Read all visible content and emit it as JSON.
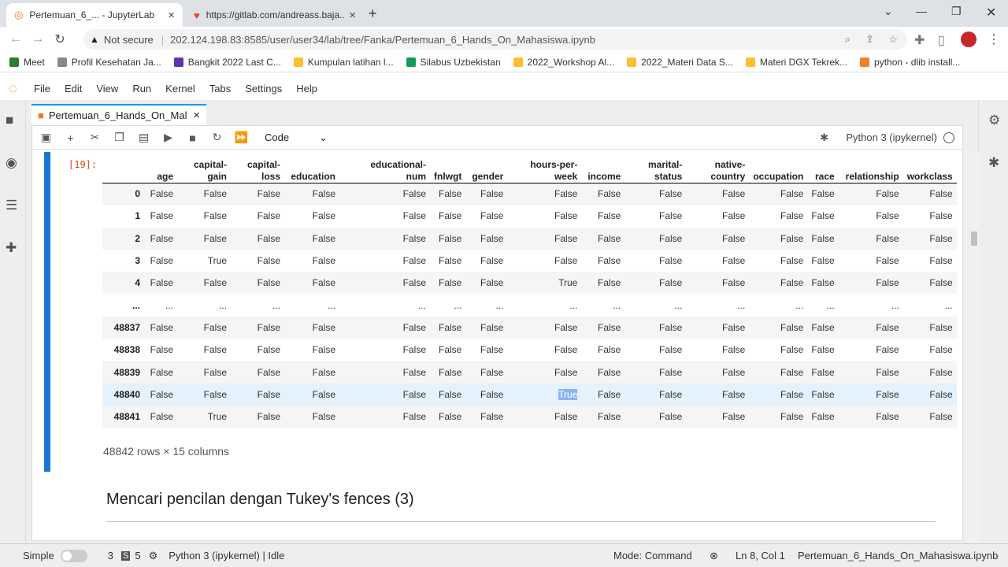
{
  "browser": {
    "tabs": [
      {
        "title": "Pertemuan_6_... - JupyterLab",
        "active": true
      },
      {
        "title": "https://gitlab.com/andreass.baja...",
        "active": false
      }
    ],
    "security_label": "Not secure",
    "url": "202.124.198.83:8585/user/user34/lab/tree/Fanka/Pertemuan_6_Hands_On_Mahasiswa.ipynb",
    "bookmarks": [
      {
        "label": "Meet",
        "color": "#2e7d32"
      },
      {
        "label": "Profil Kesehatan Ja...",
        "color": "#888888"
      },
      {
        "label": "Bangkit 2022 Last C...",
        "color": "#5e35b1"
      },
      {
        "label": "Kumpulan latihan l...",
        "color": "#fbc02d"
      },
      {
        "label": "Silabus Uzbekistan",
        "color": "#0f9d58"
      },
      {
        "label": "2022_Workshop Al...",
        "color": "#fbc02d"
      },
      {
        "label": "2022_Materi Data S...",
        "color": "#fbc02d"
      },
      {
        "label": "Materi DGX Tekrek...",
        "color": "#fbc02d"
      },
      {
        "label": "python - dlib install...",
        "color": "#f48024"
      }
    ]
  },
  "menu": [
    "File",
    "Edit",
    "View",
    "Run",
    "Kernel",
    "Tabs",
    "Settings",
    "Help"
  ],
  "notebook": {
    "tab_title": "Pertemuan_6_Hands_On_Mal",
    "cell_type": "Code",
    "kernel": "Python 3 (ipykernel)",
    "prompt": "[19]:",
    "columns": [
      "",
      "age",
      "capital-\ngain",
      "capital-\nloss",
      "education",
      "educational-\nnum",
      "fnlwgt",
      "gender",
      "hours-per-\nweek",
      "income",
      "marital-\nstatus",
      "native-\ncountry",
      "occupation",
      "race",
      "relationship",
      "workclass"
    ],
    "rows": [
      [
        "0",
        "False",
        "False",
        "False",
        "False",
        "False",
        "False",
        "False",
        "False",
        "False",
        "False",
        "False",
        "False",
        "False",
        "False",
        "False"
      ],
      [
        "1",
        "False",
        "False",
        "False",
        "False",
        "False",
        "False",
        "False",
        "False",
        "False",
        "False",
        "False",
        "False",
        "False",
        "False",
        "False"
      ],
      [
        "2",
        "False",
        "False",
        "False",
        "False",
        "False",
        "False",
        "False",
        "False",
        "False",
        "False",
        "False",
        "False",
        "False",
        "False",
        "False"
      ],
      [
        "3",
        "False",
        "True",
        "False",
        "False",
        "False",
        "False",
        "False",
        "False",
        "False",
        "False",
        "False",
        "False",
        "False",
        "False",
        "False"
      ],
      [
        "4",
        "False",
        "False",
        "False",
        "False",
        "False",
        "False",
        "False",
        "True",
        "False",
        "False",
        "False",
        "False",
        "False",
        "False",
        "False"
      ],
      [
        "...",
        "...",
        "...",
        "...",
        "...",
        "...",
        "...",
        "...",
        "...",
        "...",
        "...",
        "...",
        "...",
        "...",
        "...",
        "..."
      ],
      [
        "48837",
        "False",
        "False",
        "False",
        "False",
        "False",
        "False",
        "False",
        "False",
        "False",
        "False",
        "False",
        "False",
        "False",
        "False",
        "False"
      ],
      [
        "48838",
        "False",
        "False",
        "False",
        "False",
        "False",
        "False",
        "False",
        "False",
        "False",
        "False",
        "False",
        "False",
        "False",
        "False",
        "False"
      ],
      [
        "48839",
        "False",
        "False",
        "False",
        "False",
        "False",
        "False",
        "False",
        "False",
        "False",
        "False",
        "False",
        "False",
        "False",
        "False",
        "False"
      ],
      [
        "48840",
        "False",
        "False",
        "False",
        "False",
        "False",
        "False",
        "False",
        "True",
        "False",
        "False",
        "False",
        "False",
        "False",
        "False",
        "False"
      ],
      [
        "48841",
        "False",
        "True",
        "False",
        "False",
        "False",
        "False",
        "False",
        "False",
        "False",
        "False",
        "False",
        "False",
        "False",
        "False",
        "False"
      ]
    ],
    "shape": "48842 rows × 15 columns",
    "markdown_heading": "Mencari pencilan dengan Tukey's fences (3)"
  },
  "statusbar": {
    "mode_label": "Simple",
    "terminals": "3",
    "consoles": "5",
    "kernel_status": "Python 3 (ipykernel) | Idle",
    "mode": "Mode: Command",
    "position": "Ln 8, Col 1",
    "filename": "Pertemuan_6_Hands_On_Mahasiswa.ipynb"
  },
  "colors": {
    "accent": "#1976d2",
    "tab_accent": "#2196f3",
    "prompt": "#d84315",
    "hover_row": "#e3f2fd"
  }
}
